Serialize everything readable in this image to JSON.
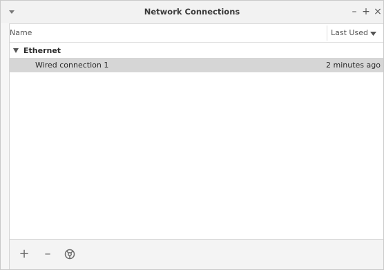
{
  "window": {
    "title": "Network Connections",
    "controls": {
      "minimize": "–",
      "maximize": "+",
      "close": "×"
    }
  },
  "table": {
    "columns": {
      "name": "Name",
      "last_used": "Last Used"
    },
    "groups": [
      {
        "label": "Ethernet",
        "rows": [
          {
            "name": "Wired connection 1",
            "last_used": "2 minutes ago",
            "selected": true
          }
        ]
      }
    ]
  },
  "toolbar": {
    "add": "+",
    "remove": "–"
  },
  "icons": {
    "window_menu": "chevron-down-icon",
    "sort": "caret-down-icon",
    "group_expander": "expander-open-icon",
    "settings": "gear-icon"
  },
  "colors": {
    "selection": "#d6d6d6",
    "titlebar": "#f2f2f2"
  }
}
